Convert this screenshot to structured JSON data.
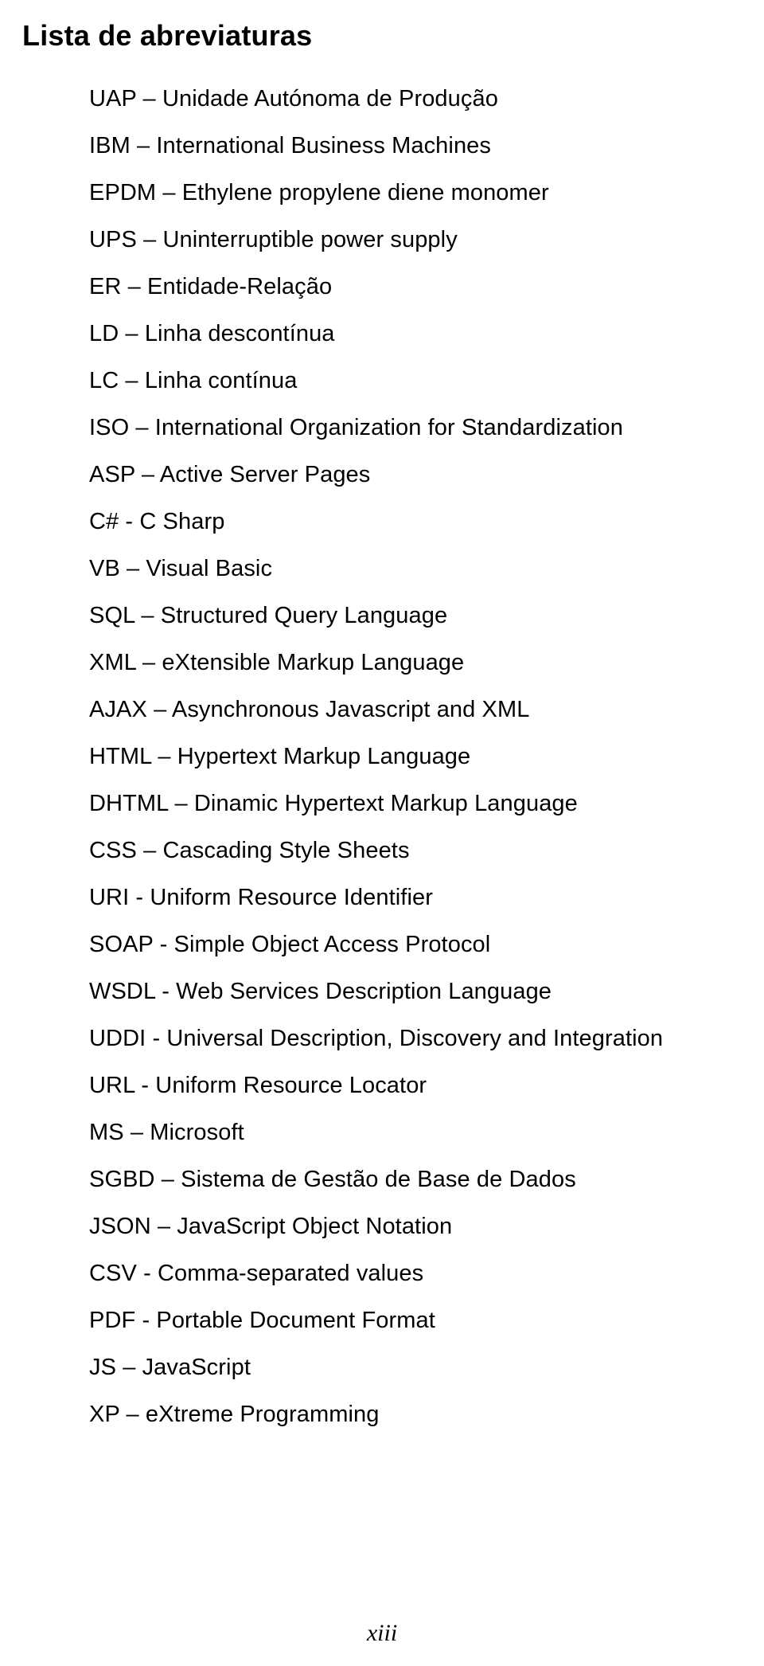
{
  "title": "Lista de abreviaturas",
  "abbreviations": [
    "UAP – Unidade Autónoma de Produção",
    "IBM – International Business Machines",
    "EPDM – Ethylene propylene diene monomer",
    "UPS – Uninterruptible power supply",
    "ER – Entidade-Relação",
    "LD – Linha descontínua",
    "LC – Linha contínua",
    "ISO – International Organization for Standardization",
    "ASP – Active Server Pages",
    "C# - C Sharp",
    "VB – Visual Basic",
    "SQL – Structured Query Language",
    "XML – eXtensible Markup Language",
    "AJAX – Asynchronous Javascript and XML",
    "HTML – Hypertext Markup Language",
    "DHTML – Dinamic Hypertext Markup Language",
    "CSS – Cascading Style Sheets",
    "URI - Uniform Resource Identifier",
    "SOAP - Simple Object Access Protocol",
    "WSDL - Web Services Description Language",
    "UDDI - Universal Description, Discovery and Integration",
    "URL - Uniform Resource Locator",
    "MS – Microsoft",
    "SGBD – Sistema de Gestão de Base de Dados",
    "JSON – JavaScript Object Notation",
    "CSV - Comma-separated values",
    "PDF - Portable Document Format",
    "JS – JavaScript",
    "XP – eXtreme Programming"
  ],
  "page_number": "xiii"
}
